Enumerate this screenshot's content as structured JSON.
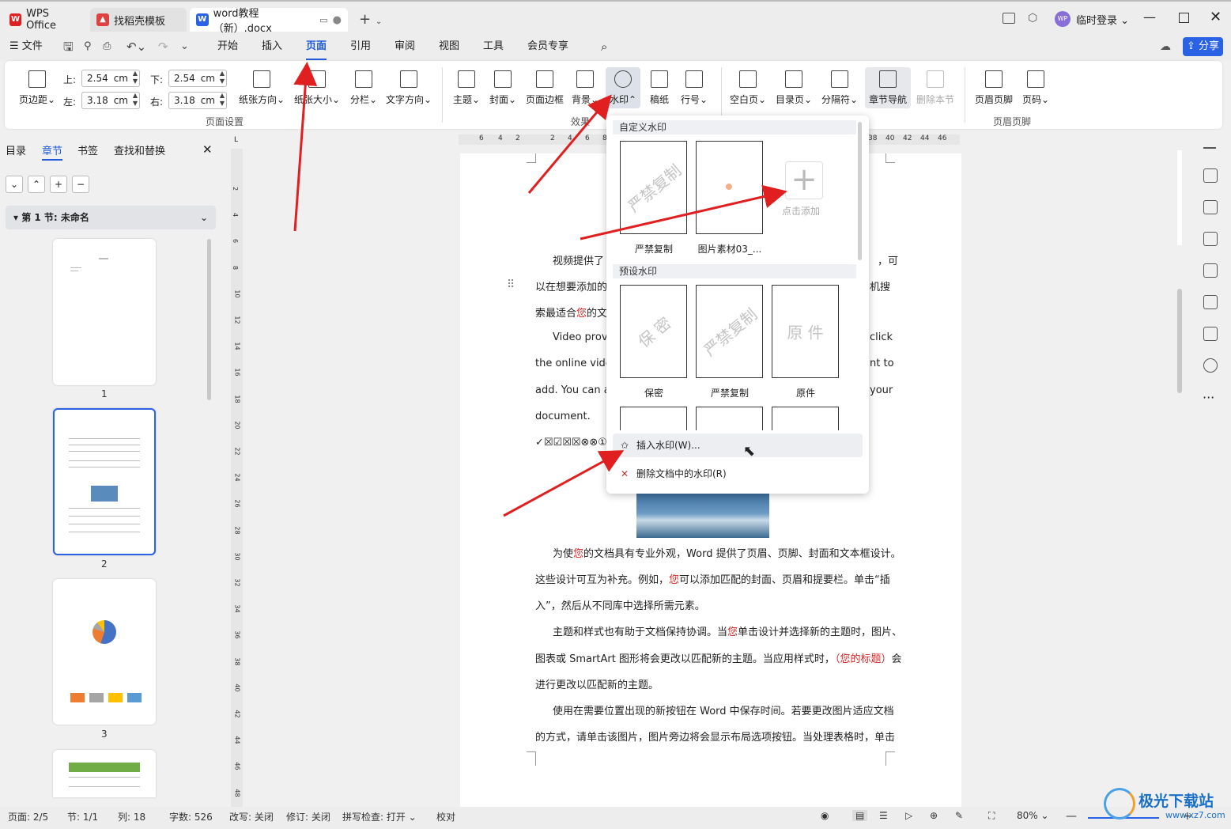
{
  "tabs": [
    {
      "label": "WPS Office"
    },
    {
      "label": "找稻壳模板"
    },
    {
      "label": "word教程（新）.docx"
    }
  ],
  "titlebar": {
    "login": "临时登录",
    "avatar": "WP"
  },
  "menu": {
    "file": "文件",
    "items": [
      "开始",
      "插入",
      "页面",
      "引用",
      "审阅",
      "视图",
      "工具",
      "会员专享"
    ],
    "share": "分享"
  },
  "ribbon": {
    "margins": "页边距",
    "top_label": "上:",
    "top_value": "2.54",
    "bottom_label": "下:",
    "bottom_value": "2.54",
    "left_label": "左:",
    "left_value": "3.18",
    "right_label": "右:",
    "right_value": "3.18",
    "unit": "cm",
    "orientation": "纸张方向",
    "size": "纸张大小",
    "columns": "分栏",
    "text_dir": "文字方向",
    "group_page": "页面设置",
    "theme": "主题",
    "cover": "封面",
    "border": "页面边框",
    "background": "背景",
    "watermark": "水印",
    "paper": "稿纸",
    "lineno": "行号",
    "group_effect": "效果",
    "blank": "空白页",
    "toc": "目录页",
    "break": "分隔符",
    "nav": "章节导航",
    "delete_section": "删除本节",
    "header_footer": "页眉页脚",
    "page_num": "页码",
    "group_hf": "页眉页脚"
  },
  "leftpanel": {
    "tabs": [
      "目录",
      "章节",
      "书签",
      "查找和替换"
    ],
    "section": "第 1 节: 未命名",
    "pages": [
      "1",
      "2",
      "3"
    ]
  },
  "ruler": {
    "h_ticks": [
      "6",
      "4",
      "2",
      "2",
      "4",
      "6",
      "8",
      "38",
      "40",
      "42",
      "44",
      "46"
    ],
    "v_ticks": [
      "2",
      "4",
      "6",
      "8",
      "10",
      "12",
      "14",
      "16",
      "18",
      "20",
      "22",
      "24",
      "26",
      "28",
      "30",
      "32",
      "34",
      "36",
      "38",
      "40",
      "42",
      "44",
      "46",
      "48"
    ]
  },
  "document": {
    "p1a": "视频提供了",
    "p1a_end": "，可",
    "p1b": "以在想要添加的",
    "p1b_end": "机搜",
    "p1c_pre": "索最适合",
    "p1c_red": "您",
    "p1c_post": "的文",
    "p2a": "Video provi",
    "p2a_end": "click",
    "p2b": "the online video,",
    "p2b_end": "nt to",
    "p2c": "add. You can als",
    "p2c_end": "your",
    "p2d": "document.",
    "symbols": "✓☒☑☒☒⊗⊗①",
    "p3a_pre": "为使",
    "p3a_red": "您",
    "p3a_post": "的文档具有专业外观，Word  提供了页眉、页脚、封面和文本框设计。",
    "p3b_pre": "这些设计可互为补充。例如，",
    "p3b_red": "您",
    "p3b_post": "可以添加匹配的封面、页眉和提要栏。单击“插",
    "p3c": "入”，然后从不同库中选择所需元素。",
    "p4a_pre": "主题和样式也有助于文档保持协调。当",
    "p4a_red": "您",
    "p4a_post": "单击设计并选择新的主题时，图片、",
    "p4b_pre": "图表或  SmartArt  图形将会更改以匹配新的主题。当应用样式时，",
    "p4b_red": "（您的标题）",
    "p4b_post": "会",
    "p4c": "进行更改以匹配新的主题。",
    "p5a": "使用在需要位置出现的新按钮在  Word  中保存时间。若要更改图片适应文档",
    "p5b": "的方式，请单击该图片，图片旁边将会显示布局选项按钮。当处理表格时，单击"
  },
  "dropdown": {
    "custom_header": "自定义水印",
    "custom": [
      {
        "text": "严禁复制",
        "label": "严禁复制"
      },
      {
        "text": "",
        "label": "图片素材03_..."
      }
    ],
    "add_label": "点击添加",
    "preset_header": "预设水印",
    "preset": [
      {
        "text": "保  密",
        "label": "保密"
      },
      {
        "text": "严禁复制",
        "label": "严禁复制"
      },
      {
        "text": "原  件",
        "label": "原件"
      }
    ],
    "insert": "插入水印(W)...",
    "remove": "删除文档中的水印(R)"
  },
  "statusbar": {
    "page": "页面: 2/5",
    "section": "节: 1/1",
    "col": "列: 18",
    "words": "字数: 526",
    "track": "改写: 关闭",
    "revise": "修订: 关闭",
    "spell": "拼写检查: 打开",
    "proof": "校对",
    "zoom": "80%"
  },
  "watermark_logo": {
    "text": "极光下载站",
    "url_text": "www.xz7.com"
  },
  "colors": {
    "accent": "#1f5bd6",
    "arrow": "#e02020",
    "red_text": "#dd2222"
  }
}
